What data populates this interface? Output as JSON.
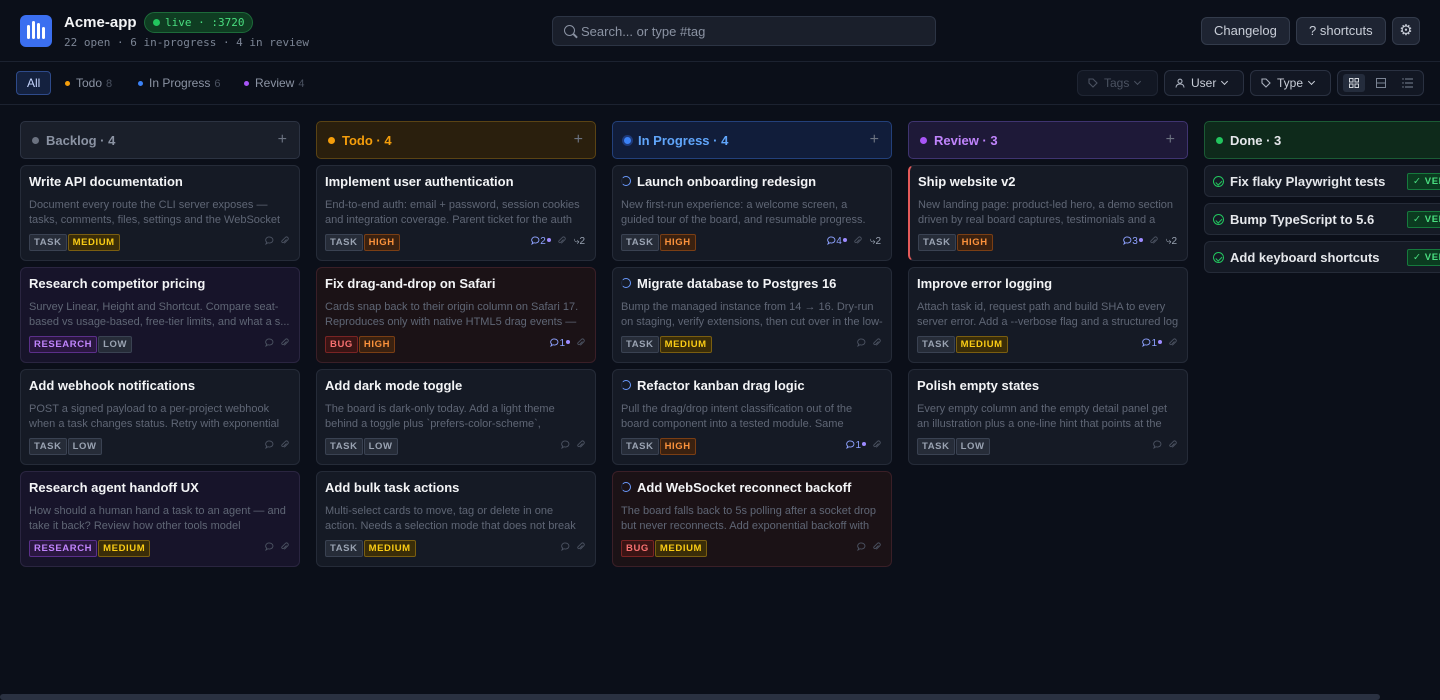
{
  "header": {
    "app_title": "Acme-app",
    "live_badge": "live · :3720",
    "summary": "22 open · 6 in-progress · 4 in review",
    "search_placeholder": "Search... or type #tag",
    "changelog_label": "Changelog",
    "shortcuts_label": "? shortcuts",
    "settings_icon": "gear-icon"
  },
  "filters": {
    "tabs": [
      {
        "label": "All",
        "count": ""
      },
      {
        "label": "Todo",
        "count": "8"
      },
      {
        "label": "In Progress",
        "count": "6"
      },
      {
        "label": "Review",
        "count": "4"
      }
    ],
    "tags_label": "Tags",
    "user_label": "User",
    "type_label": "Type",
    "views": [
      "board-view-icon",
      "table-view-icon",
      "list-view-icon"
    ]
  },
  "colors": {
    "backlog": "#6b7280",
    "todo": "#f59e0b",
    "in_progress": "#3b82f6",
    "review": "#a855f7",
    "done": "#22c55e",
    "bug": "#ef4444"
  },
  "columns": [
    {
      "title": "Backlog · 4",
      "cards": [
        {
          "title": "Write API documentation",
          "desc": "Document every route the CLI server exposes — tasks, comments, files, settings and the WebSocket protocol.",
          "badges": [
            "TASK",
            "MEDIUM"
          ],
          "comments": "",
          "subtasks": ""
        },
        {
          "title": "Research competitor pricing",
          "desc": "Survey Linear, Height and Shortcut. Compare seat-based vs usage-based, free-tier limits, and what a s...",
          "badges": [
            "RESEARCH",
            "LOW"
          ],
          "comments": "",
          "subtasks": ""
        },
        {
          "title": "Add webhook notifications",
          "desc": "POST a signed payload to a per-project webhook when a task changes status. Retry with exponential backoff.",
          "badges": [
            "TASK",
            "LOW"
          ],
          "comments": "",
          "subtasks": ""
        },
        {
          "title": "Research agent handoff UX",
          "desc": "How should a human hand a task to an agent — and take it back? Review how other tools model ownershi...",
          "badges": [
            "RESEARCH",
            "MEDIUM"
          ],
          "comments": "",
          "subtasks": ""
        }
      ]
    },
    {
      "title": "Todo · 4",
      "cards": [
        {
          "title": "Implement user authentication",
          "desc": "End-to-end auth: email + password, session cookies and integration coverage. Parent ticket for the auth work.",
          "badges": [
            "TASK",
            "HIGH"
          ],
          "comments": "2",
          "subtasks": "2"
        },
        {
          "title": "Fix drag-and-drop on Safari",
          "desc": "Cards snap back to their origin column on Safari 17. Reproduces only with native HTML5 drag events — Chrome is fine.",
          "badges": [
            "BUG",
            "HIGH"
          ],
          "comments": "1",
          "subtasks": "",
          "bug": true
        },
        {
          "title": "Add dark mode toggle",
          "desc": "The board is dark-only today. Add a light theme behind a toggle plus `prefers-color-scheme`, persisted per user.",
          "badges": [
            "TASK",
            "LOW"
          ],
          "comments": "",
          "subtasks": ""
        },
        {
          "title": "Add bulk task actions",
          "desc": "Multi-select cards to move, tag or delete in one action. Needs a selection mode that does not break drag-and-drop.",
          "badges": [
            "TASK",
            "MEDIUM"
          ],
          "comments": "",
          "subtasks": ""
        }
      ]
    },
    {
      "title": "In Progress · 4",
      "cards": [
        {
          "title": "Launch onboarding redesign",
          "desc": "New first-run experience: a welcome screen, a guided tour of the board, and resumable progress. Parent ticket.",
          "badges": [
            "TASK",
            "HIGH"
          ],
          "comments": "4",
          "subtasks": "2"
        },
        {
          "title": "Migrate database to Postgres 16",
          "desc": "Bump the managed instance from 14 → 16. Dry-run on staging, verify extensions, then cut over in the low-traffic window.",
          "badges": [
            "TASK",
            "MEDIUM"
          ],
          "comments": "",
          "subtasks": ""
        },
        {
          "title": "Refactor kanban drag logic",
          "desc": "Pull the drag/drop intent classification out of the board component into a tested module. Same behaviour, better tests.",
          "badges": [
            "TASK",
            "HIGH"
          ],
          "comments": "1",
          "subtasks": ""
        },
        {
          "title": "Add WebSocket reconnect backoff",
          "desc": "The board falls back to 5s polling after a socket drop but never reconnects. Add exponential backoff with jitter.",
          "badges": [
            "BUG",
            "MEDIUM"
          ],
          "comments": "",
          "subtasks": "",
          "bug": true
        }
      ]
    },
    {
      "title": "Review · 3",
      "cards": [
        {
          "title": "Ship website v2",
          "desc": "New landing page: product-led hero, a demo section driven by real board captures, testimonials and a pricing table.",
          "badges": [
            "TASK",
            "HIGH"
          ],
          "comments": "3",
          "subtasks": "2",
          "accent": true
        },
        {
          "title": "Improve error logging",
          "desc": "Attach task id, request path and build SHA to every server error. Add a --verbose flag and a structured log format.",
          "badges": [
            "TASK",
            "MEDIUM"
          ],
          "comments": "1",
          "subtasks": ""
        },
        {
          "title": "Polish empty states",
          "desc": "Every empty column and the empty detail panel get an illustration plus a one-line hint that points at the next action.",
          "badges": [
            "TASK",
            "LOW"
          ],
          "comments": "",
          "subtasks": ""
        }
      ]
    },
    {
      "title": "Done · 3",
      "cards": [
        {
          "title": "Fix flaky Playwright tests",
          "badge": "✓ VERIFIED"
        },
        {
          "title": "Bump TypeScript to 5.6",
          "badge": "✓ VERIFIED"
        },
        {
          "title": "Add keyboard shortcuts",
          "badge": "✓ VERIFIED"
        }
      ]
    }
  ]
}
